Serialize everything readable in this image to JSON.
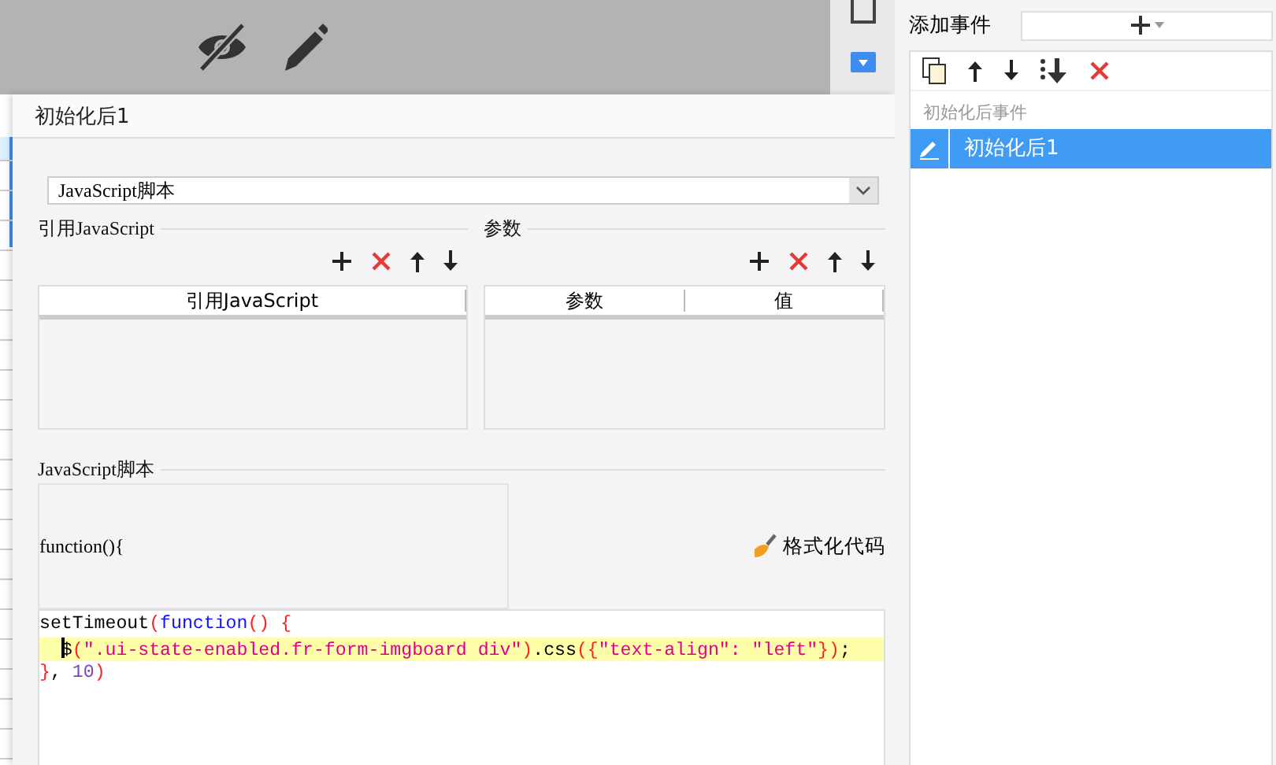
{
  "dialog": {
    "title": "初始化后1",
    "script_type": "JavaScript脚本",
    "references": {
      "legend": "引用JavaScript",
      "columns": [
        "引用JavaScript"
      ]
    },
    "parameters": {
      "legend": "参数",
      "columns": [
        "参数",
        "值"
      ]
    },
    "script": {
      "legend": "JavaScript脚本",
      "signature": "function(){",
      "format_button": "格式化代码",
      "lines": [
        {
          "highlighted": false,
          "cursor": false,
          "tokens": [
            {
              "text": "setTimeout",
              "kind": "plain"
            },
            {
              "text": "(",
              "kind": "bracket"
            },
            {
              "text": "function",
              "kind": "keyword"
            },
            {
              "text": "() {",
              "kind": "bracket"
            }
          ]
        },
        {
          "highlighted": true,
          "cursor": true,
          "tokens": [
            {
              "text": "  $",
              "kind": "plain"
            },
            {
              "text": "(",
              "kind": "bracket"
            },
            {
              "text": "\".ui-state-enabled.fr-form-imgboard div\"",
              "kind": "string"
            },
            {
              "text": ")",
              "kind": "bracket"
            },
            {
              "text": ".css",
              "kind": "plain"
            },
            {
              "text": "({",
              "kind": "bracket"
            },
            {
              "text": "\"text-align\": \"left\"",
              "kind": "string"
            },
            {
              "text": "})",
              "kind": "bracket"
            },
            {
              "text": ";",
              "kind": "plain"
            }
          ]
        },
        {
          "highlighted": false,
          "cursor": false,
          "tokens": [
            {
              "text": "}",
              "kind": "bracket"
            },
            {
              "text": ", ",
              "kind": "plain"
            },
            {
              "text": "10",
              "kind": "number"
            },
            {
              "text": ")",
              "kind": "bracket"
            }
          ]
        }
      ]
    }
  },
  "event_panel": {
    "add_label": "添加事件",
    "group": "初始化后事件",
    "events": [
      {
        "label": "初始化后1",
        "selected": true
      }
    ]
  }
}
